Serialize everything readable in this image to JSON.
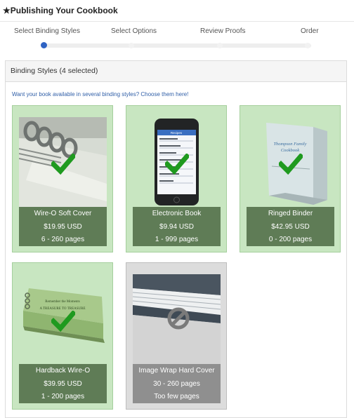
{
  "header": {
    "title": "★Publishing Your Cookbook"
  },
  "steps": [
    {
      "label": "Select Binding Styles",
      "active": true
    },
    {
      "label": "Select Options",
      "active": false
    },
    {
      "label": "Review Proofs",
      "active": false
    },
    {
      "label": "Order",
      "active": false
    }
  ],
  "panel": {
    "title": "Binding Styles (4 selected)",
    "intro": "Want your book available in several binding styles? Choose them here!"
  },
  "phone_screen": {
    "title": "Recipes"
  },
  "binder_cover": {
    "lines": [
      "Thompson Family",
      "Cookbook"
    ]
  },
  "hardback_cover": {
    "lines": [
      "Remember the Moments",
      "A TREASURE TO TREASURE"
    ]
  },
  "bindings": [
    {
      "name": "Wire-O Soft Cover",
      "price": "$19.95 USD",
      "pages": "6 - 260 pages",
      "selected": true
    },
    {
      "name": "Electronic Book",
      "price": "$9.94 USD",
      "pages": "1 - 999 pages",
      "selected": true
    },
    {
      "name": "Ringed Binder",
      "price": "$42.95 USD",
      "pages": "0 - 200 pages",
      "selected": true
    },
    {
      "name": "Hardback Wire-O",
      "price": "$39.95 USD",
      "pages": "1 - 200 pages",
      "selected": true
    },
    {
      "name": "Image Wrap Hard Cover",
      "price": "30 - 260 pages",
      "pages": "Too few pages",
      "selected": false,
      "disabled": true
    }
  ],
  "colors": {
    "selected_bg": "#c8e6c1",
    "label_bg": "#5f7c56",
    "disabled_bg": "#dcdcdc",
    "check": "#1f9a1f",
    "active_step": "#2f63c3",
    "link_text": "#2f5ea7"
  },
  "icons": {
    "selected": "check-icon",
    "unavailable": "not-allowed-icon"
  }
}
